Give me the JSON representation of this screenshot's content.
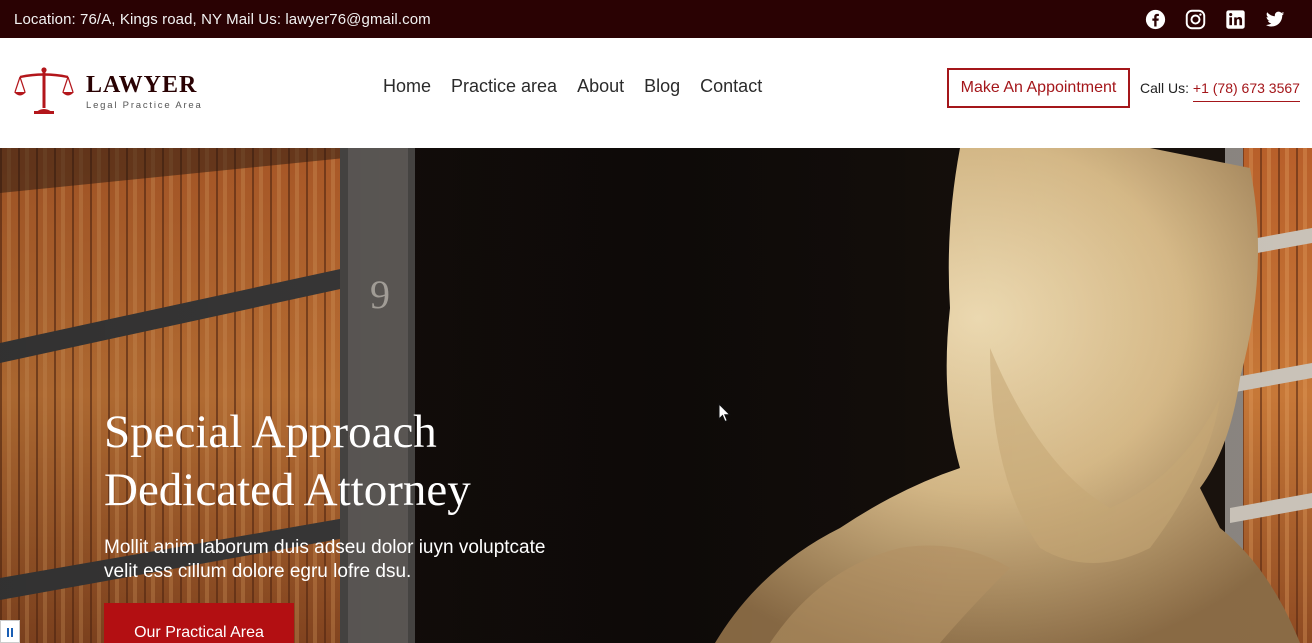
{
  "topbar": {
    "info": "Location: 76/A, Kings road, NY Mail Us: lawyer76@gmail.com",
    "social": [
      "facebook-icon",
      "instagram-icon",
      "linkedin-icon",
      "twitter-icon"
    ]
  },
  "logo": {
    "title": "LAWYER",
    "subtitle": "Legal Practice Area"
  },
  "nav": {
    "items": [
      "Home",
      "Practice area",
      "About",
      "Blog",
      "Contact"
    ]
  },
  "header": {
    "cta_label": "Make An Appointment",
    "call_label": "Call Us:",
    "phone": "+1 (78) 673 3567"
  },
  "hero": {
    "title_line1": "Special Approach",
    "title_line2": "Dedicated Attorney",
    "description_line1": "Mollit anim laborum duis adseu dolor iuyn voluptcate",
    "description_line2": "velit ess cillum dolore egru lofre dsu.",
    "button_label": "Our Practical Area"
  },
  "colors": {
    "topbar_bg": "#2a0203",
    "accent": "#a4161a",
    "button_bg": "#b30f12"
  }
}
